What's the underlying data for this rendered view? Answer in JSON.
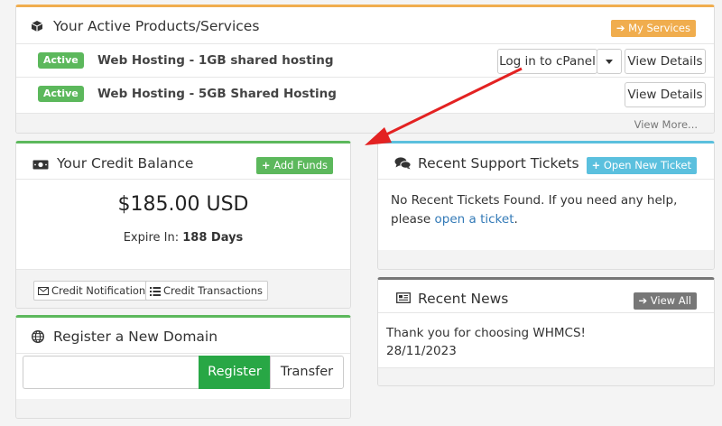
{
  "products": {
    "title": "Your Active Products/Services",
    "my_services_label": "My Services",
    "view_more_label": "View More...",
    "items": [
      {
        "status": "Active",
        "name": "Web Hosting - 1GB shared hosting",
        "login_label": "Log in to cPanel",
        "details_label": "View Details"
      },
      {
        "status": "Active",
        "name": "Web Hosting - 5GB Shared Hosting",
        "details_label": "View Details"
      }
    ]
  },
  "credit": {
    "title": "Your Credit Balance",
    "add_funds_label": "Add Funds",
    "amount": "$185.00 USD",
    "expire_label": "Expire In:",
    "expire_value": "188 Days",
    "notification_label": "Credit Notification",
    "transactions_label": "Credit Transactions"
  },
  "tickets": {
    "title": "Recent Support Tickets",
    "open_label": "Open New Ticket",
    "message": "No Recent Tickets Found. If you need any help, please",
    "link_text": "open a ticket",
    "link_suffix": "."
  },
  "news": {
    "title": "Recent News",
    "view_all_label": "View All",
    "item_text": "Thank you for choosing WHMCS!",
    "item_date": "28/11/2023"
  },
  "domain": {
    "title": "Register a New Domain",
    "input_value": "",
    "register_label": "Register",
    "transfer_label": "Transfer"
  },
  "colors": {
    "orange": "#f0ad4e",
    "green": "#5cb85c",
    "blue": "#5bc0de",
    "gray": "#777777",
    "register_green": "#28a745",
    "arrow_red": "#e32222"
  }
}
